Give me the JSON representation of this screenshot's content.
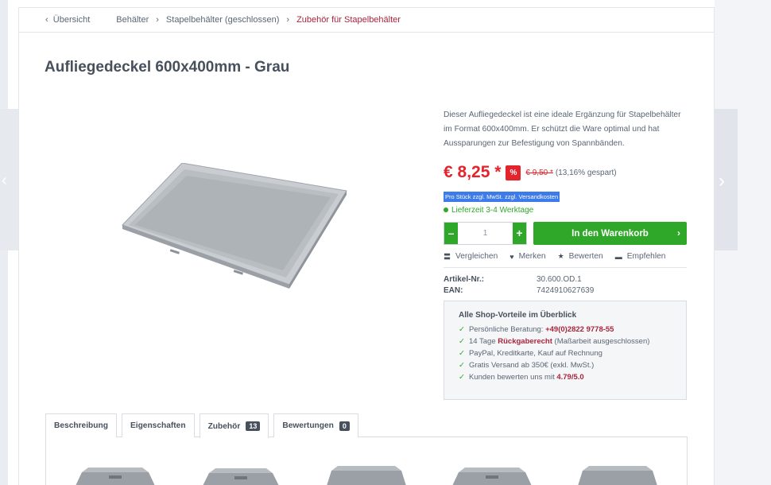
{
  "breadcrumb": {
    "back": "Übersicht",
    "items": [
      "Behälter",
      "Stapelbehälter (geschlossen)"
    ],
    "current": "Zubehör für Stapelbehälter"
  },
  "product": {
    "title": "Aufliegedeckel 600x400mm - Grau",
    "description": "Dieser Aufliegedeckel ist eine ideale Ergänzung für Stapelbehälter im Format 600x400mm. Er schützt die Ware optimal und hat Aussparungen zur Befestigung von Spannbänden.",
    "price": "€ 8,25 *",
    "discount_badge": "%",
    "old_price": "€ 9,50 *",
    "saving": "(13,16% gespart)",
    "tax_note": "Pro Stück zzgl. MwSt. zzgl. Versandkosten",
    "delivery": "Lieferzeit 3-4 Werktage",
    "quantity": "1",
    "minus": "–",
    "plus": "+",
    "cart_label": "In den Warenkorb",
    "cart_chevron": "›"
  },
  "actions": [
    {
      "label": "Vergleichen",
      "icon": "compare-icon",
      "glyph": "〓"
    },
    {
      "label": "Merken",
      "icon": "heart-icon",
      "glyph": "♥"
    },
    {
      "label": "Bewerten",
      "icon": "star-icon",
      "glyph": "★"
    },
    {
      "label": "Empfehlen",
      "icon": "chat-icon",
      "glyph": "▬"
    }
  ],
  "specs": [
    {
      "key": "Artikel-Nr.:",
      "value": "30.600.OD.1"
    },
    {
      "key": "EAN:",
      "value": "7424910627639"
    }
  ],
  "perks": {
    "title": "Alle Shop-Vorteile im Überblick",
    "items": [
      {
        "pre": "Persönliche Beratung: ",
        "hl": "+49(0)2822 9778-55",
        "post": ""
      },
      {
        "pre": "14 Tage ",
        "hl": "Rückgaberecht",
        "post": " (Maßarbeit ausgeschlossen)"
      },
      {
        "pre": "PayPal, Kreditkarte, Kauf auf Rechnung",
        "hl": "",
        "post": ""
      },
      {
        "pre": "Gratis Versand ab 350€ (exkl. MwSt.)",
        "hl": "",
        "post": ""
      },
      {
        "pre": "Kunden bewerten uns mit ",
        "hl": "4.79/5.0",
        "post": ""
      }
    ]
  },
  "tabs": [
    {
      "label": "Beschreibung",
      "count": ""
    },
    {
      "label": "Eigenschaften",
      "count": ""
    },
    {
      "label": "Zubehör",
      "count": "13"
    },
    {
      "label": "Bewertungen",
      "count": "0"
    }
  ],
  "colors": {
    "accent_red": "#e4242c",
    "green": "#2fa829",
    "breadcrumb_active": "#a9253c",
    "selection_blue": "#3d7be8"
  }
}
